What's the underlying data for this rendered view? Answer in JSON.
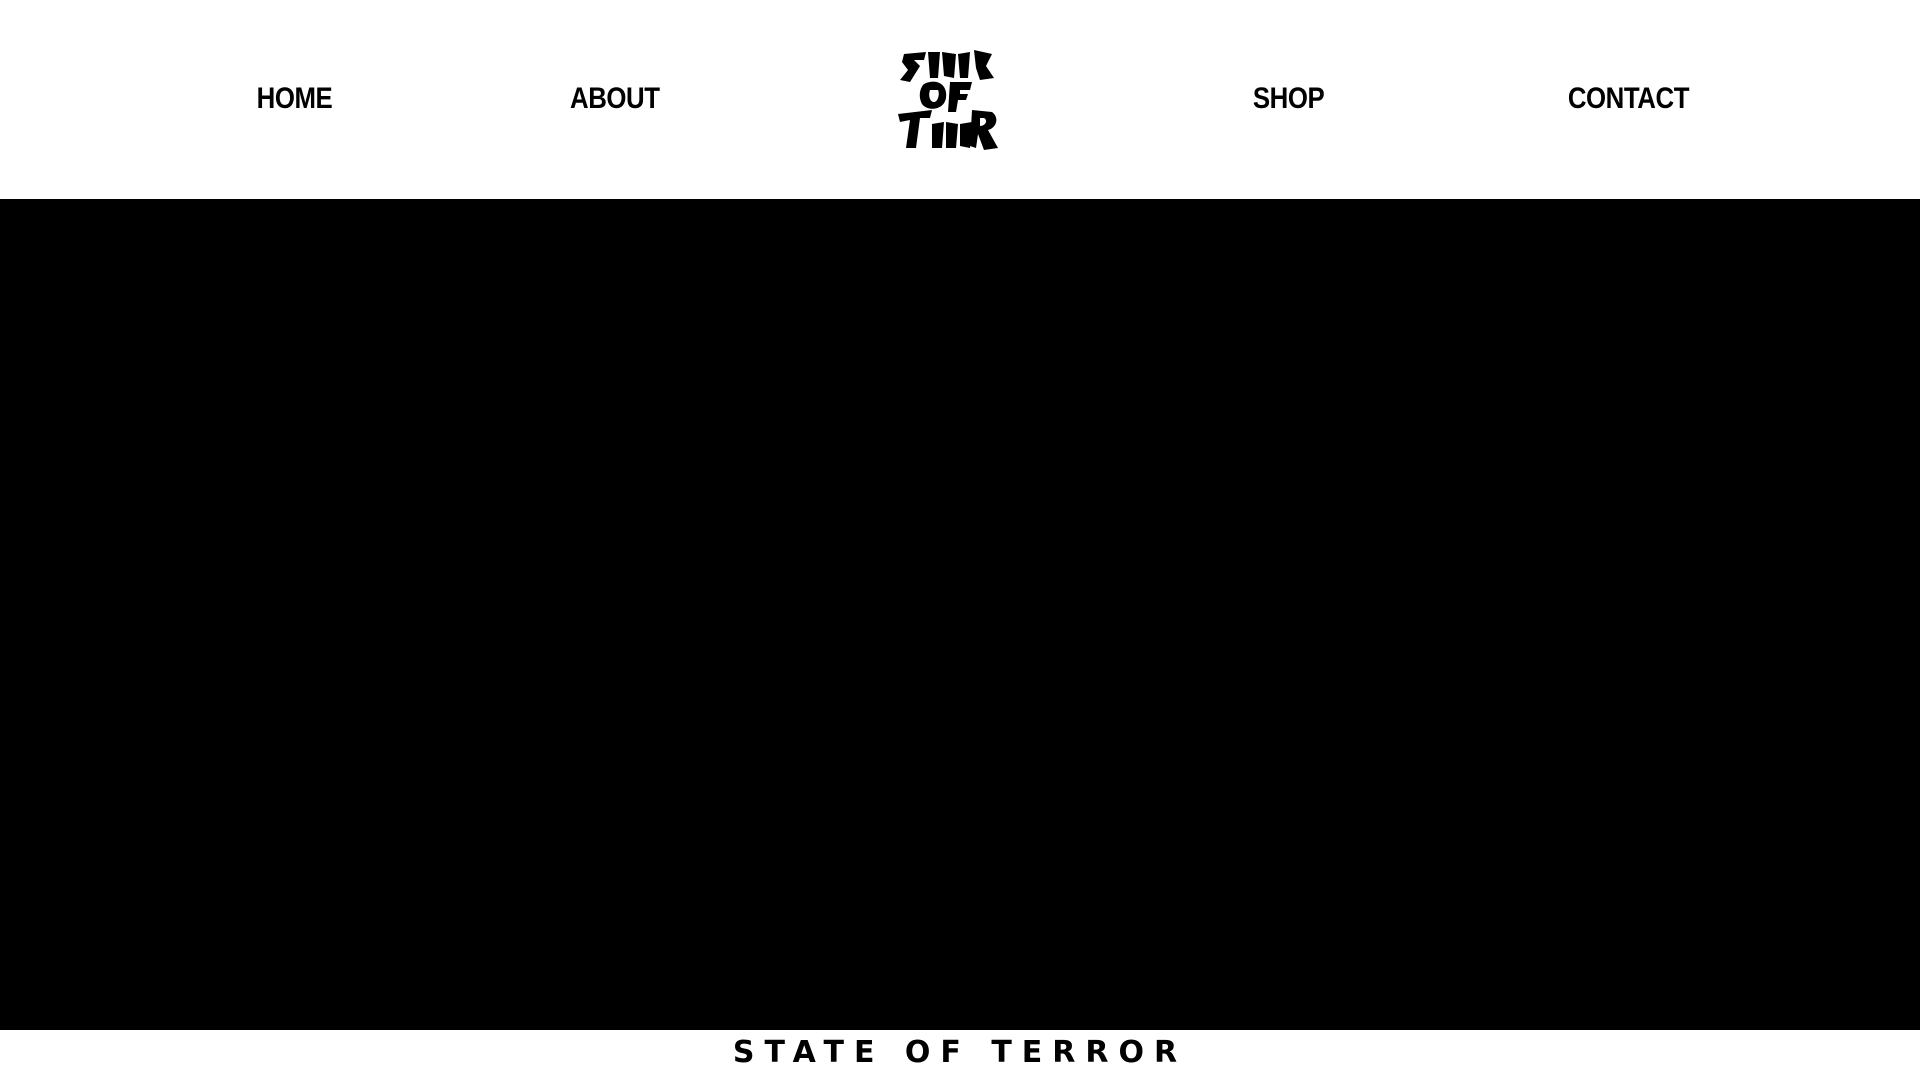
{
  "nav": {
    "home": "HOME",
    "about": "ABOUT",
    "shop": "SHOP",
    "contact": "CONTACT"
  },
  "logo": {
    "icon": "state-of-terror-blackletter-logo",
    "lines": [
      "STATE",
      "OF",
      "TERROR"
    ]
  },
  "hero": {
    "background": "#000000"
  },
  "footer": {
    "title": "STATE OF TERROR"
  },
  "colors": {
    "page_background": "#ffffff",
    "text": "#000000",
    "hero": "#000000"
  }
}
